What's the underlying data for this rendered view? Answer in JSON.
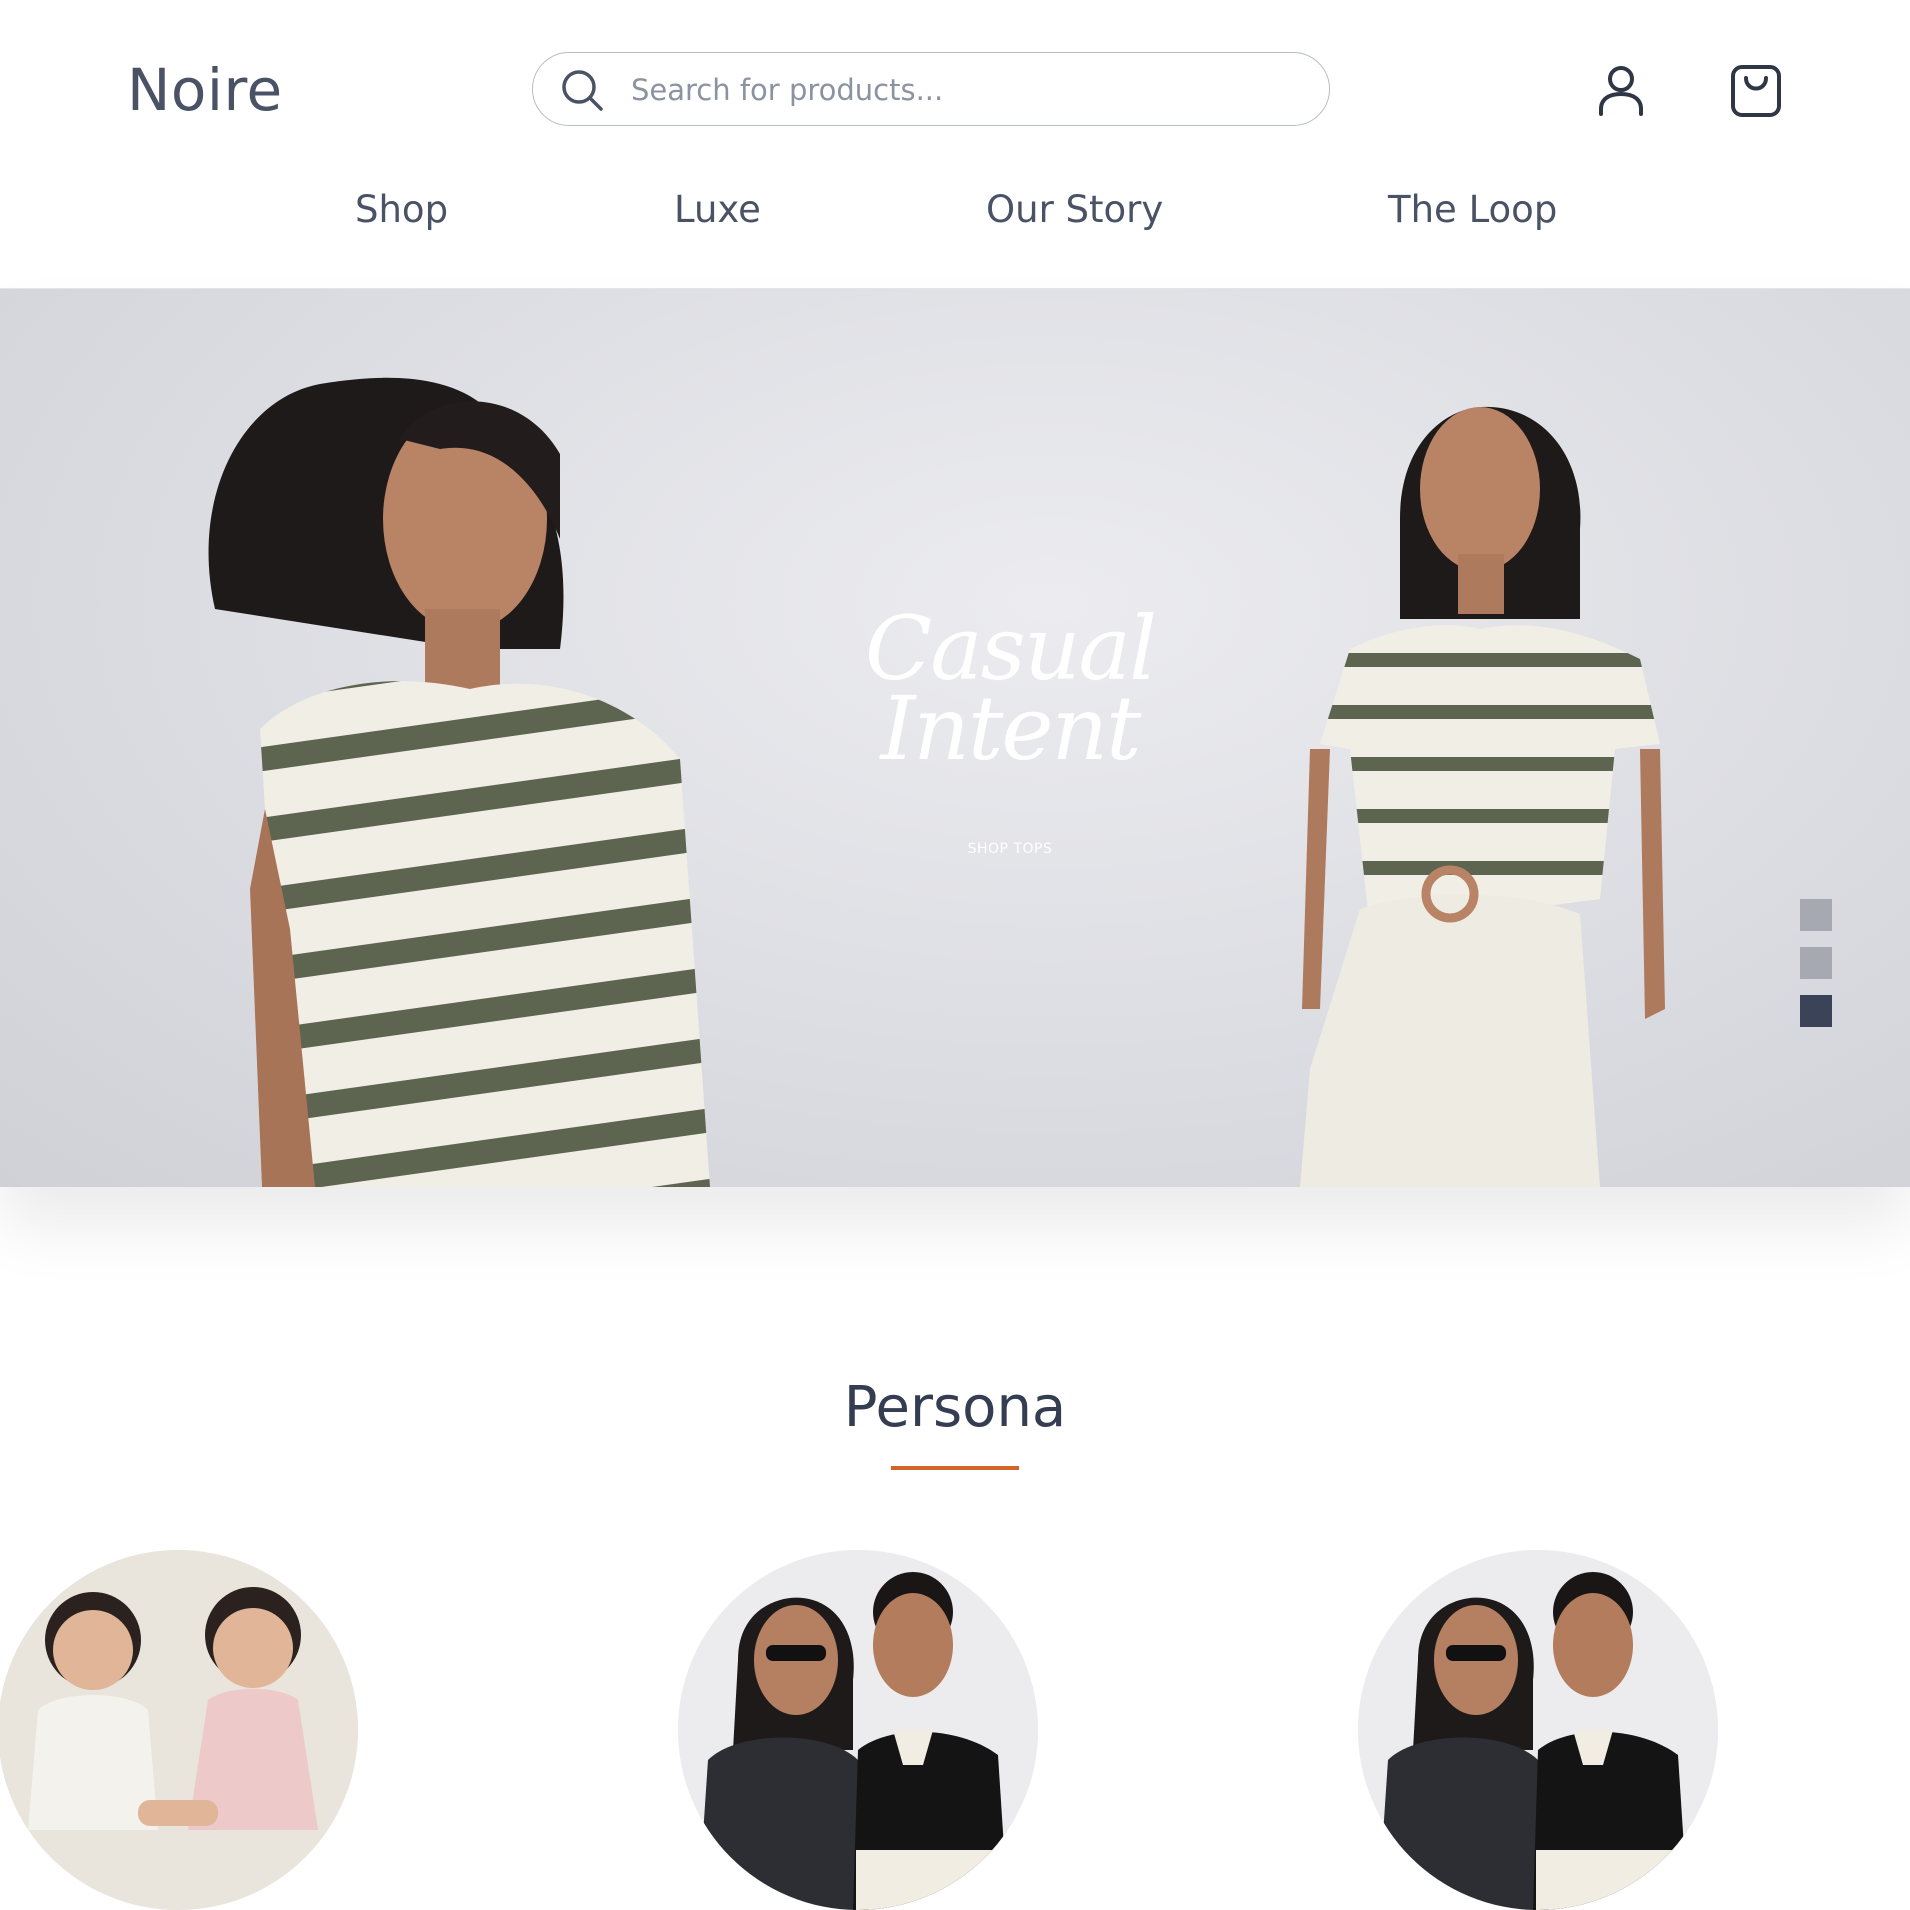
{
  "brand": {
    "name": "Noire"
  },
  "search": {
    "placeholder": "Search for products..."
  },
  "header": {
    "icons": [
      "search-icon",
      "user-icon",
      "shopping-bag-icon"
    ]
  },
  "nav": {
    "items": [
      "Shop",
      "Luxe",
      "Our Story",
      "The Loop"
    ]
  },
  "hero": {
    "title_line1": "Casual",
    "title_line2": "Intent",
    "cta": "SHOP TOPS",
    "slides": 3,
    "active_slide": 3
  },
  "persona": {
    "title": "Persona",
    "accent_color": "#d2652b",
    "items": [
      {
        "image": "two toddlers holding hands"
      },
      {
        "image": "couple in black tops with sunglasses"
      },
      {
        "image": "couple in black tops with sunglasses"
      }
    ]
  },
  "colors": {
    "text": "#4a5366",
    "dot_active": "#3a4357",
    "dot_inactive": "#a6a9b1"
  }
}
